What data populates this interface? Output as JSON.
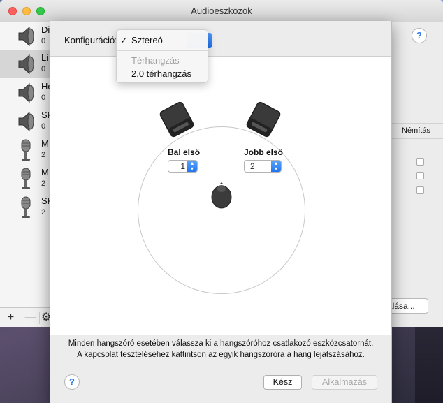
{
  "window": {
    "title": "Audioeszközök"
  },
  "devices": [
    {
      "name": "Di",
      "sub": "0",
      "type": "speaker",
      "selected": false
    },
    {
      "name": "Li",
      "sub": "0",
      "type": "speaker",
      "selected": true
    },
    {
      "name": "He",
      "sub": "0",
      "type": "speaker",
      "selected": false
    },
    {
      "name": "SF",
      "sub": "0",
      "type": "speaker",
      "selected": false
    },
    {
      "name": "M",
      "sub": "2",
      "type": "microphone",
      "selected": false
    },
    {
      "name": "M",
      "sub": "2",
      "type": "microphone",
      "selected": false
    },
    {
      "name": "SF",
      "sub": "2",
      "type": "microphone",
      "selected": false
    }
  ],
  "sidebar_toolbar": {
    "add": "+",
    "remove": "—"
  },
  "right_panel": {
    "help": "?",
    "mute_header": "Némítás",
    "partial_button": "álása..."
  },
  "sheet": {
    "config_label": "Konfiguráció:",
    "menu": {
      "selected": {
        "check": "✓",
        "label": "Sztereó"
      },
      "section_header": "Térhangzás",
      "options": [
        "2.0 térhangzás"
      ]
    },
    "speakers": {
      "left": {
        "label": "Bal első",
        "channel": "1"
      },
      "right": {
        "label": "Jobb első",
        "channel": "2"
      }
    },
    "instructions_line1": "Minden hangszóró esetében válassza ki a hangszóróhoz csatlakozó eszközcsatornát.",
    "instructions_line2": "A kapcsolat teszteléséhez kattintson az egyik hangszóróra a hang lejátszásához.",
    "help": "?",
    "done_button": "Kész",
    "apply_button": "Alkalmazás"
  },
  "colors": {
    "accent": "#1d6ff0",
    "close": "#fc605c",
    "minimize": "#fdbc40",
    "maximize": "#34c84a"
  }
}
